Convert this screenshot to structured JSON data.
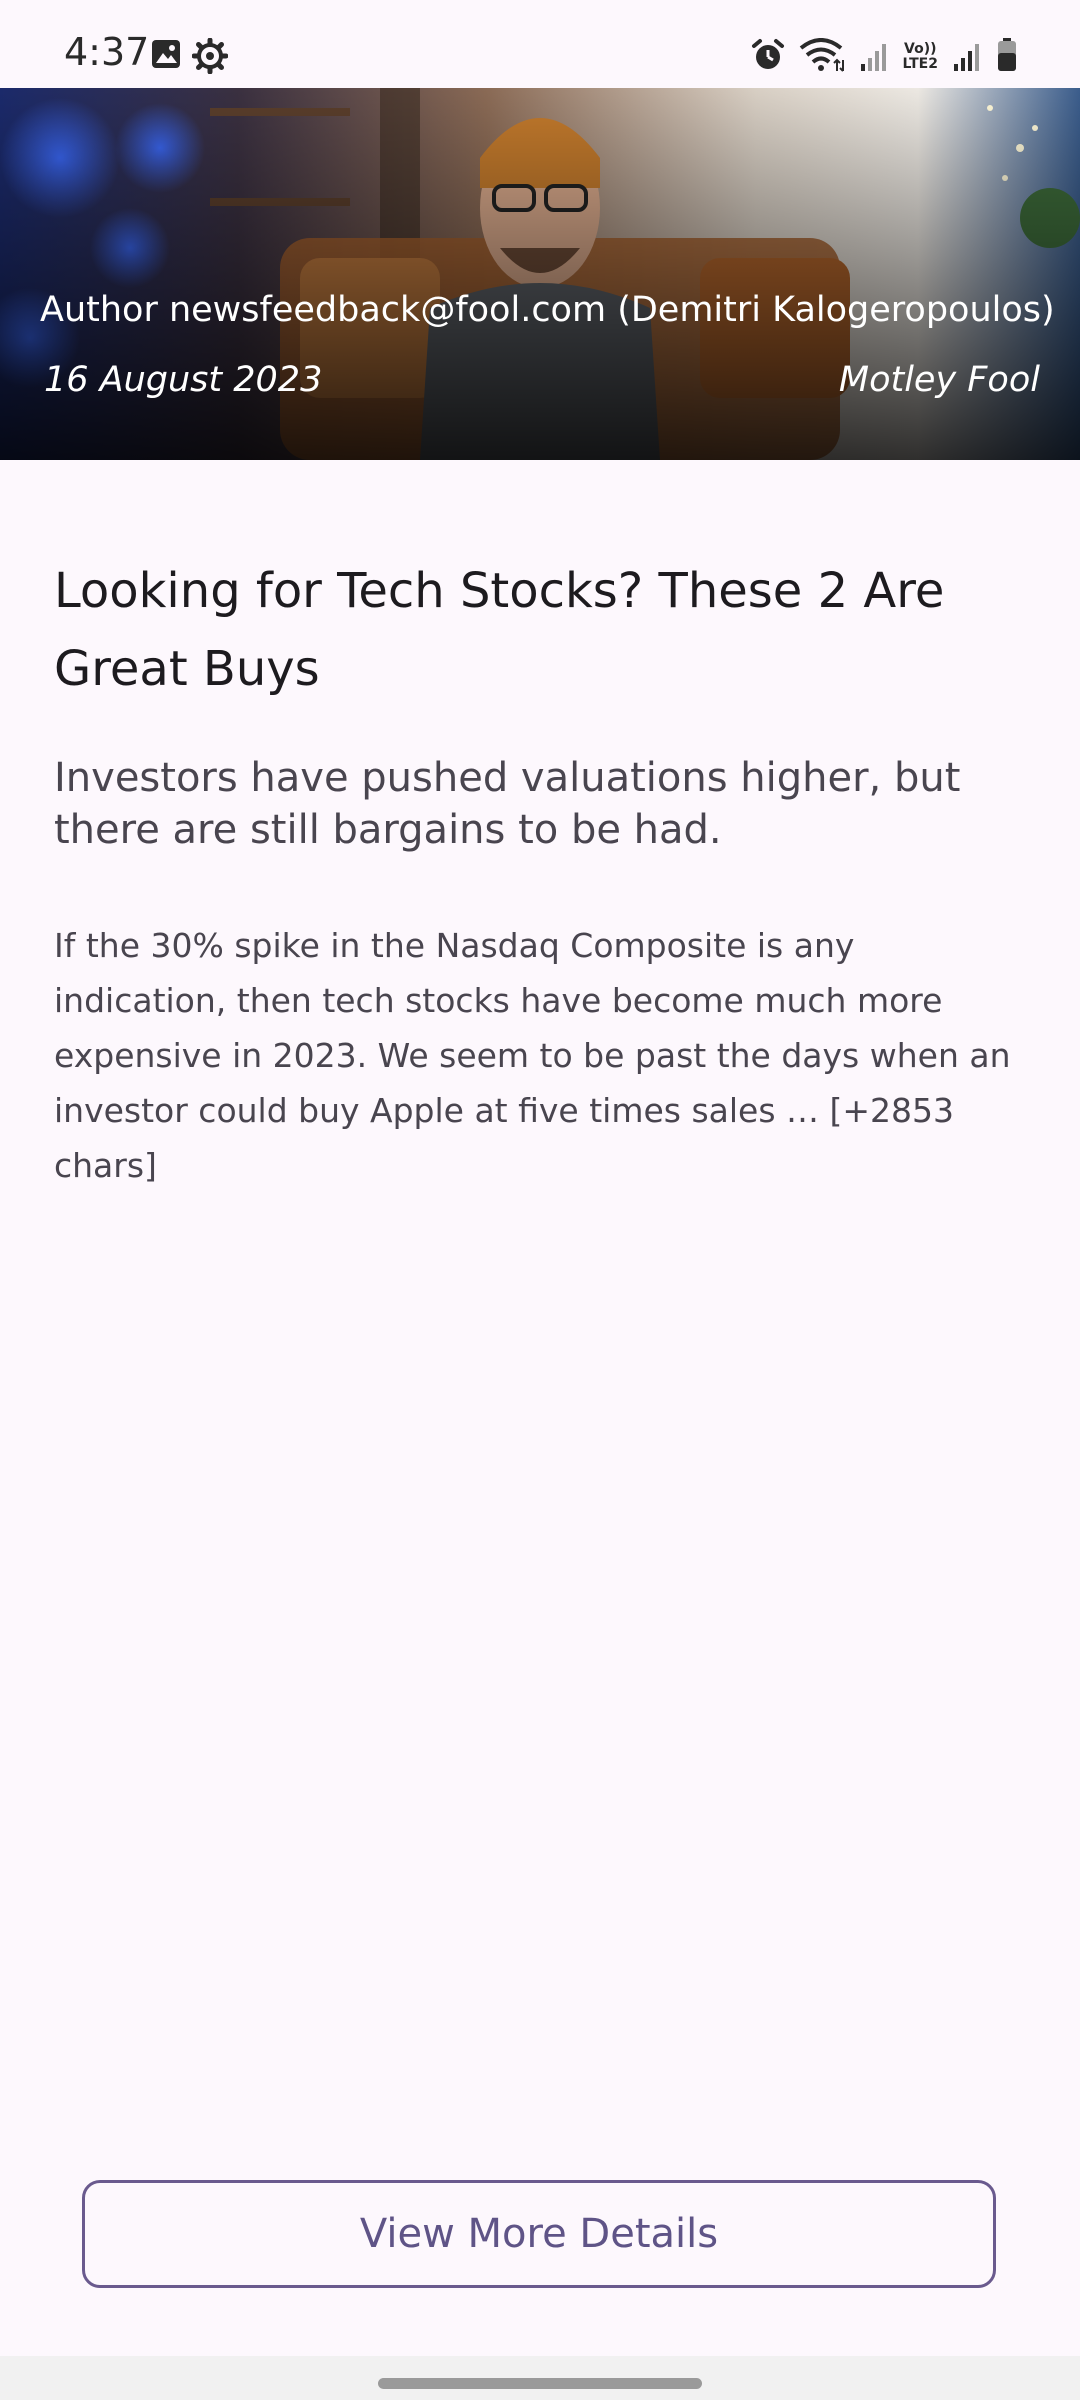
{
  "status_bar": {
    "time": "4:37",
    "left_icons": [
      "image-icon",
      "settings-gear-icon"
    ],
    "right_icons": [
      "alarm-icon",
      "wifi-icon",
      "signal-icon",
      "volte-lte2-icon",
      "signal-icon",
      "battery-icon"
    ],
    "network_label_top": "Vo))",
    "network_label_bottom": "LTE2"
  },
  "hero": {
    "author": "Author newsfeedback@fool.com (Demitri Kalogeropoulos)",
    "date": "16 August 2023",
    "source": "Motley Fool"
  },
  "article": {
    "title": "Looking for Tech Stocks? These 2 Are Great Buys",
    "subtitle": "Investors have pushed valuations higher, but there are still bargains to be had.",
    "body": "If the 30% spike in the Nasdaq Composite is any indication, then tech stocks have become much more expensive in 2023. We seem to be past the days when an investor could buy Apple at five times sales … [+2853 chars]"
  },
  "actions": {
    "view_more_label": "View More Details"
  },
  "colors": {
    "background": "#fdf8fd",
    "button_border": "#6a5a8e",
    "button_text": "#5f5487"
  }
}
